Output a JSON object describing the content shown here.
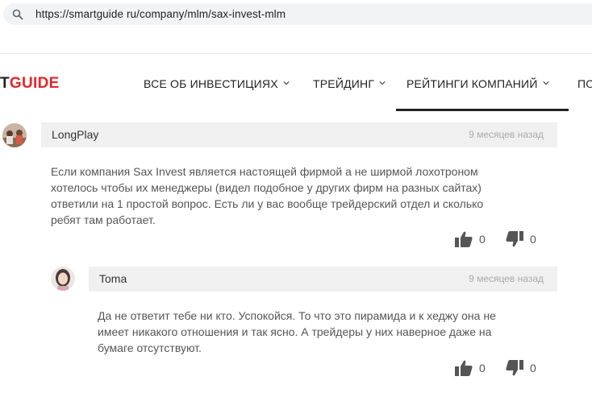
{
  "browser": {
    "url": "https://smartguide ru/company/mlm/sax-invest-mlm"
  },
  "site": {
    "logo_dark": "T",
    "logo_red": "GUIDE",
    "nav": [
      {
        "label": "ВСЕ ОБ ИНВЕСТИЦИЯХ"
      },
      {
        "label": "ТРЕЙДИНГ"
      },
      {
        "label": "РЕЙТИНГИ КОМПАНИЙ"
      },
      {
        "label": "ПО"
      }
    ]
  },
  "comments": [
    {
      "author": "LongPlay",
      "date": "9 месяцев назад",
      "lines": [
        "Если компания Sax Invest является настоящей фирмой а не ширмой лохотроном",
        "хотелось чтобы их менеджеры (видел подобное у других фирм на разных сайтах)",
        "ответили на 1 простой вопрос. Есть ли у вас вообще трейдерский отдел и сколько",
        "ребят там работает."
      ],
      "likes": "0",
      "dislikes": "0"
    },
    {
      "author": "Toma",
      "date": "9 месяцев назад",
      "lines": [
        "Да не ответит тебе ни кто. Успокойся. То что это пирамида и к хеджу она не",
        "имеет никакого отношения и так ясно. А трейдеры у них наверное даже на",
        "бумаге отсутствуют."
      ],
      "likes": "0",
      "dislikes": "0"
    }
  ],
  "colors": {
    "accent": "#e3262b",
    "header_bg": "#f0f0f0"
  }
}
